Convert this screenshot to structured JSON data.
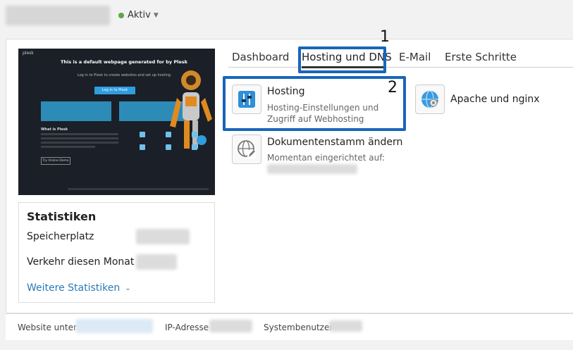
{
  "header": {
    "status_label": "Aktiv"
  },
  "preview": {
    "brand": "plesk",
    "title": "This is a default webpage generated for by Plesk",
    "subtitle": "Log in to Plesk to create websites and set up hosting",
    "login_button": "Log in to Plesk",
    "what_heading": "What is Plesk",
    "demo_button": "Try Online Demo"
  },
  "stats": {
    "title": "Statistiken",
    "storage_label": "Speicherplatz",
    "traffic_label": "Verkehr diesen Monat",
    "more_label": "Weitere Statistiken"
  },
  "tabs": [
    {
      "label": "Dashboard"
    },
    {
      "label": "Hosting und DNS"
    },
    {
      "label": "E-Mail"
    },
    {
      "label": "Erste Schritte"
    }
  ],
  "annotations": {
    "num1": "1",
    "num2": "2",
    "color": "#1766b9"
  },
  "tools": {
    "hosting": {
      "name": "Hosting",
      "desc": "Hosting-Einstellungen und Zugriff auf Webhosting",
      "icon": "sliders-icon"
    },
    "apache": {
      "name": "Apache und nginx",
      "icon": "globe-gear-icon"
    },
    "docroot": {
      "name": "Dokumentenstamm ändern",
      "desc": "Momentan eingerichtet auf:",
      "icon": "globe-edit-icon"
    }
  },
  "footer": {
    "website_label": "Website unter",
    "ip_label": "IP-Adresse",
    "sysuser_label": "Systembenutzer"
  },
  "colors": {
    "status_green": "#5aa74a",
    "link_blue": "#2a7ab8",
    "annotation_blue": "#1766b9"
  }
}
